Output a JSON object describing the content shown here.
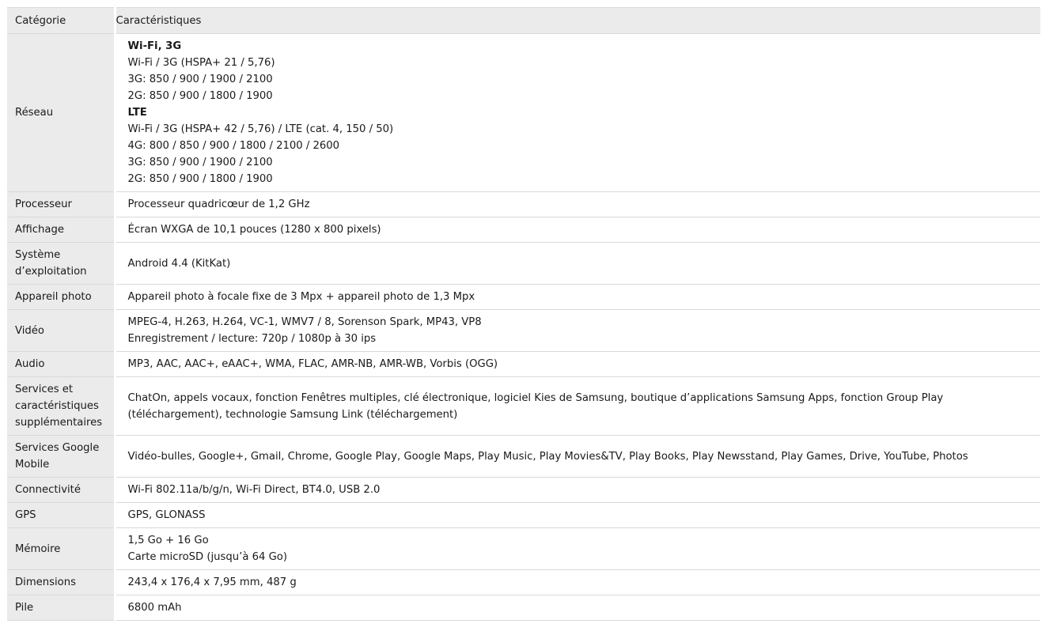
{
  "header": {
    "category": "Catégorie",
    "features": "Caractéristiques"
  },
  "rows": [
    {
      "category": "Réseau",
      "lines": [
        {
          "text": "Wi-Fi, 3G",
          "bold": true
        },
        {
          "text": "Wi-Fi / 3G (HSPA+ 21 / 5,76)"
        },
        {
          "text": "3G: 850 / 900 / 1900 / 2100"
        },
        {
          "text": "2G: 850 / 900 / 1800 / 1900"
        },
        {
          "text": "LTE",
          "bold": true
        },
        {
          "text": "Wi-Fi / 3G (HSPA+ 42 / 5,76) / LTE (cat. 4, 150 / 50)"
        },
        {
          "text": "4G: 800 / 850 / 900 / 1800 / 2100 / 2600"
        },
        {
          "text": "3G: 850 / 900 / 1900 / 2100"
        },
        {
          "text": "2G: 850 / 900 / 1800 / 1900"
        }
      ]
    },
    {
      "category": "Processeur",
      "lines": [
        {
          "text": "Processeur quadricœur de 1,2 GHz"
        }
      ]
    },
    {
      "category": "Affichage",
      "lines": [
        {
          "text": "Écran WXGA de 10,1 pouces (1280 x 800 pixels)"
        }
      ]
    },
    {
      "category": "Système d’exploitation",
      "lines": [
        {
          "text": "Android 4.4 (KitKat)"
        }
      ]
    },
    {
      "category": "Appareil photo",
      "lines": [
        {
          "text": "Appareil photo à focale fixe de 3 Mpx + appareil photo de 1,3 Mpx"
        }
      ]
    },
    {
      "category": "Vidéo",
      "lines": [
        {
          "text": "MPEG-4, H.263, H.264, VC-1, WMV7 / 8, Sorenson Spark, MP43, VP8"
        },
        {
          "text": "Enregistrement / lecture: 720p / 1080p à 30 ips"
        }
      ]
    },
    {
      "category": "Audio",
      "lines": [
        {
          "text": "MP3, AAC, AAC+, eAAC+, WMA, FLAC, AMR-NB, AMR-WB, Vorbis (OGG)"
        }
      ]
    },
    {
      "category": "Services et caractéristiques supplémentaires",
      "lines": [
        {
          "text": "ChatOn, appels vocaux, fonction Fenêtres multiples, clé électronique, logiciel Kies de Samsung, boutique d’applications Samsung Apps, fonction Group Play (téléchargement), technologie Samsung Link (téléchargement)",
          "wrap": true
        }
      ]
    },
    {
      "category": "Services Google Mobile",
      "lines": [
        {
          "text": "Vidéo-bulles, Google+, Gmail, Chrome, Google Play, Google Maps, Play Music, Play Movies&TV, Play Books, Play Newsstand, Play Games, Drive, YouTube, Photos"
        }
      ]
    },
    {
      "category": "Connectivité",
      "lines": [
        {
          "text": "Wi-Fi 802.11a/b/g/n, Wi-Fi Direct, BT4.0, USB 2.0"
        }
      ]
    },
    {
      "category": "GPS",
      "lines": [
        {
          "text": "GPS, GLONASS"
        }
      ]
    },
    {
      "category": "Mémoire",
      "lines": [
        {
          "text": "1,5 Go + 16 Go"
        },
        {
          "text": "Carte microSD (jusqu’à 64 Go)"
        }
      ]
    },
    {
      "category": "Dimensions",
      "lines": [
        {
          "text": "243,4 x 176,4 x 7,95 mm, 487 g"
        }
      ]
    },
    {
      "category": "Pile",
      "lines": [
        {
          "text": "6800 mAh"
        }
      ]
    }
  ]
}
